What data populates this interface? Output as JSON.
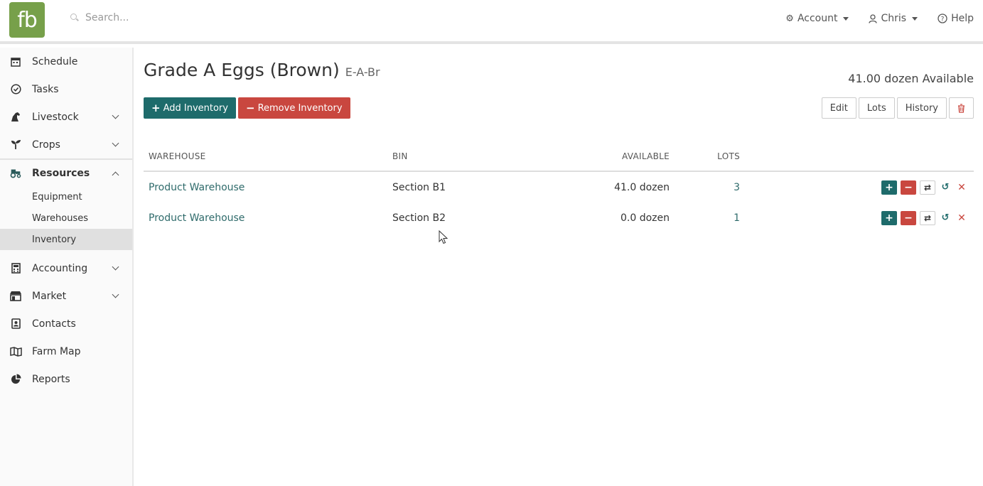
{
  "topbar": {
    "logo_text": "fb",
    "search_placeholder": "Search...",
    "account_label": "Account",
    "user_label": "Chris",
    "help_label": "Help"
  },
  "sidebar": {
    "items": [
      {
        "label": "Schedule",
        "icon": "calendar-icon"
      },
      {
        "label": "Tasks",
        "icon": "check-circle-icon"
      },
      {
        "label": "Livestock",
        "icon": "horse-icon"
      },
      {
        "label": "Crops",
        "icon": "seedling-icon"
      },
      {
        "label": "Resources",
        "icon": "tractor-icon"
      },
      {
        "label": "Accounting",
        "icon": "calculator-icon"
      },
      {
        "label": "Market",
        "icon": "store-icon"
      },
      {
        "label": "Contacts",
        "icon": "contact-card-icon"
      },
      {
        "label": "Farm Map",
        "icon": "map-icon"
      },
      {
        "label": "Reports",
        "icon": "pie-chart-icon"
      }
    ],
    "resources_sub": [
      "Equipment",
      "Warehouses",
      "Inventory"
    ]
  },
  "page": {
    "title": "Grade A Eggs (Brown)",
    "sku": "E-A-Br",
    "available": "41.00 dozen Available",
    "add_label": "Add Inventory",
    "remove_label": "Remove Inventory",
    "edit_label": "Edit",
    "lots_label": "Lots",
    "history_label": "History"
  },
  "table": {
    "headers": [
      "WAREHOUSE",
      "BIN",
      "AVAILABLE",
      "LOTS"
    ],
    "rows": [
      {
        "warehouse": "Product Warehouse",
        "bin": "Section B1",
        "available": "41.0 dozen",
        "lots": "3"
      },
      {
        "warehouse": "Product Warehouse",
        "bin": "Section B2",
        "available": "0.0 dozen",
        "lots": "1"
      }
    ]
  },
  "colors": {
    "brand": "#77a04a",
    "teal": "#1e6b6b",
    "red": "#c9473f"
  }
}
